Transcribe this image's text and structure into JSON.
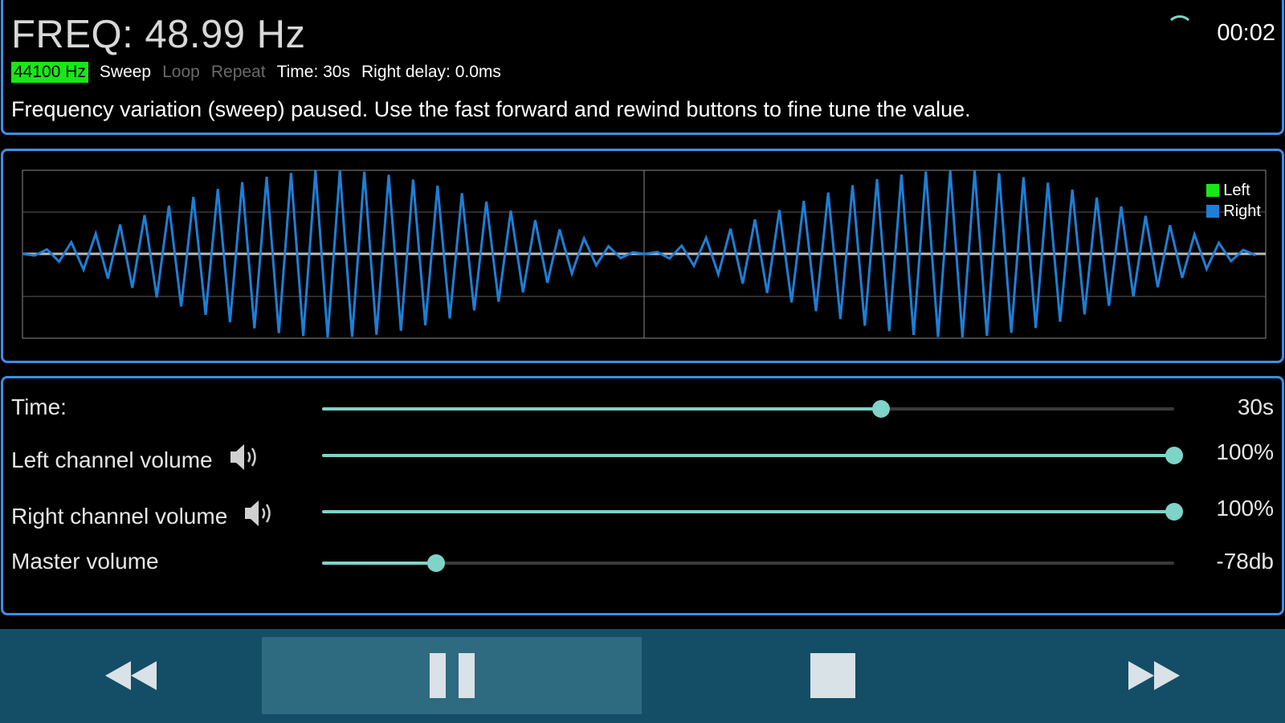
{
  "header": {
    "frequency_label": "FREQ: 48.99 Hz",
    "elapsed": "00:02",
    "sample_rate": "44100 Hz",
    "mode_sweep": "Sweep",
    "mode_loop": "Loop",
    "mode_repeat": "Repeat",
    "time_info": "Time: 30s",
    "delay_info": "Right delay: 0.0ms",
    "message": "Frequency variation (sweep) paused. Use the fast forward and rewind buttons to fine tune the value."
  },
  "waveform": {
    "legend": [
      {
        "name": "Left",
        "color": "#17e817"
      },
      {
        "name": "Right",
        "color": "#1e7fd6"
      }
    ],
    "line_color": "#1e7fd6",
    "baseline_color": "#bdbdbd"
  },
  "controls": [
    {
      "label": "Time:",
      "value": "30s",
      "fraction": 0.656,
      "speaker_icon": false
    },
    {
      "label": "Left channel volume",
      "value": "100%",
      "fraction": 1.0,
      "speaker_icon": true
    },
    {
      "label": "Right channel volume",
      "value": "100%",
      "fraction": 1.0,
      "speaker_icon": true
    },
    {
      "label": "Master volume",
      "value": "-78db",
      "fraction": 0.134,
      "speaker_icon": false
    }
  ],
  "transport": {
    "buttons": [
      "rewind-icon",
      "pause-icon",
      "stop-icon",
      "fast-forward-icon"
    ],
    "icon_color": "#d9e2e6"
  },
  "colors": {
    "accent": "#7fd3c8",
    "panel_border": "#3b8fe8",
    "transport_bg": "#134e66",
    "transport_active": "#2e6a80"
  }
}
